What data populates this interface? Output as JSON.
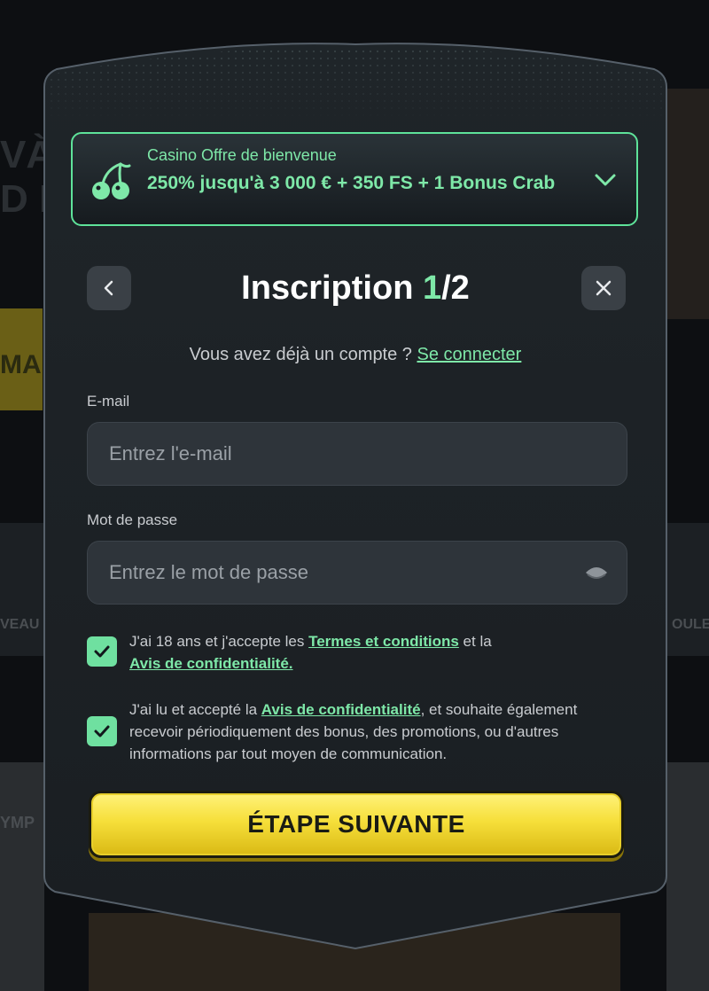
{
  "background": {
    "left_letters": "VÀ\nD F",
    "left_button_text": "MA",
    "left_word": "VEAU",
    "right_word": "OULE",
    "left_card_text": "YMP"
  },
  "offer": {
    "eyebrow": "Casino Offre de bienvenue",
    "headline": "250% jusqu'à 3 000 € + 350 FS + 1 Bonus Crab",
    "icon": "cherry-icon"
  },
  "header": {
    "title_prefix": "Inscription ",
    "title_step": "1",
    "title_suffix": "/2",
    "back_icon": "chevron-left-icon",
    "close_icon": "close-icon"
  },
  "login": {
    "prompt": "Vous avez déjà un compte ? ",
    "link": "Se connecter"
  },
  "form": {
    "email_label": "E-mail",
    "email_placeholder": "Entrez l'e-mail",
    "email_value": "",
    "password_label": "Mot de passe",
    "password_placeholder": "Entrez le mot de passe",
    "password_value": ""
  },
  "consents": [
    {
      "checked": true,
      "text_before": "J'ai 18 ans et j'accepte les ",
      "link1": "Termes et conditions",
      "text_middle": " et la ",
      "link2": "Avis de confidentialité."
    },
    {
      "checked": true,
      "text_before": "J'ai lu et accepté la ",
      "link1": "Avis de confidentialité",
      "text_after": ", et souhaite également recevoir périodiquement des bonus, des promotions, ou d'autres informations par tout moyen de communication."
    }
  ],
  "next_button": "ÉTAPE SUIVANTE",
  "colors": {
    "accent": "#7ee8a8",
    "button": "#f6df3a",
    "panel": "#1c2126"
  }
}
